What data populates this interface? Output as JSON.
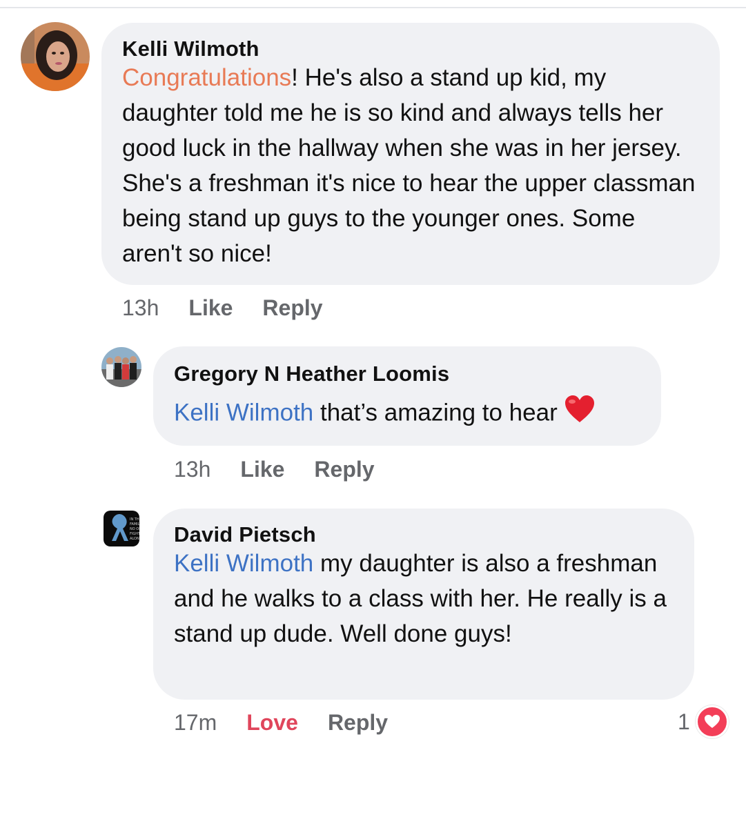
{
  "comments": [
    {
      "author": "Kelli Wilmoth",
      "highlight": "Congratulations",
      "text": "! He's also a stand up kid, my daughter told me he is so kind and always tells her good luck in the hallway when she was in her jersey. She's a freshman it's nice to hear the upper classman being stand up guys to the younger ones. Some aren't so nice!",
      "time": "13h",
      "like_label": "Like",
      "reply_label": "Reply"
    },
    {
      "author": "Gregory N Heather Loomis",
      "mention": "Kelli Wilmoth",
      "text": " that’s amazing to hear ",
      "emoji": "❤️",
      "time": "13h",
      "like_label": "Like",
      "reply_label": "Reply"
    },
    {
      "author": "David Pietsch",
      "mention": "Kelli Wilmoth",
      "text": " my daughter is also a freshman and he walks to a class with her. He really is a stand up dude. Well done guys!",
      "time": "17m",
      "reaction_label": "Love",
      "reply_label": "Reply",
      "reaction_count": "1",
      "reaction_icon": "heart-icon",
      "avatar_text": "IN THIS FAMILY NO ONE FIGHTS ALONE"
    }
  ],
  "colors": {
    "bubble": "#f0f1f4",
    "mention": "#3d72c4",
    "highlight": "#e87a55",
    "love": "#e0455b"
  }
}
